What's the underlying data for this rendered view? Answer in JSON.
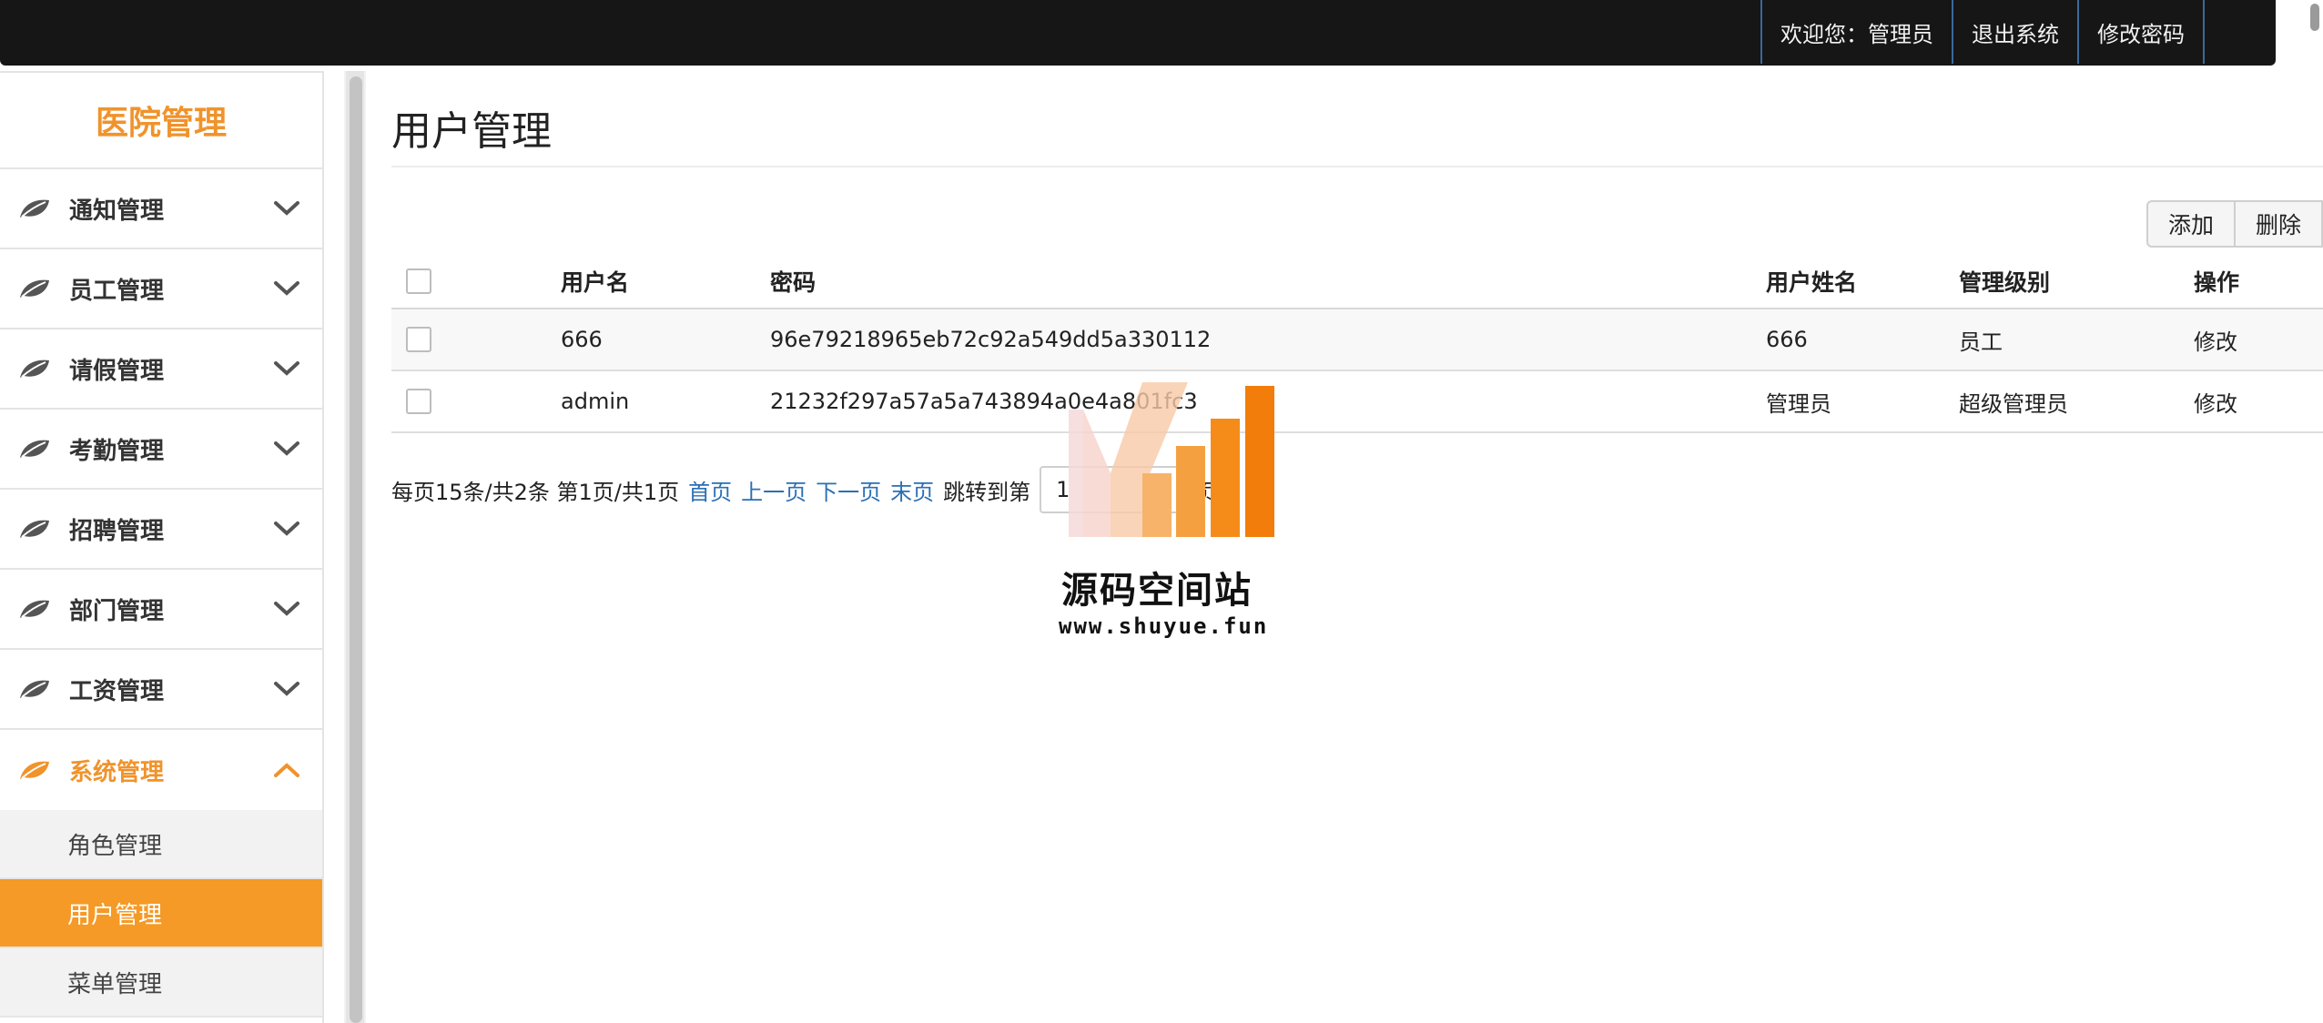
{
  "header": {
    "welcome": "欢迎您：管理员",
    "logout": "退出系统",
    "change_password": "修改密码"
  },
  "sidebar": {
    "brand": "医院管理",
    "items": [
      {
        "label": "通知管理"
      },
      {
        "label": "员工管理"
      },
      {
        "label": "请假管理"
      },
      {
        "label": "考勤管理"
      },
      {
        "label": "招聘管理"
      },
      {
        "label": "部门管理"
      },
      {
        "label": "工资管理"
      },
      {
        "label": "系统管理"
      }
    ],
    "subitems": [
      {
        "label": "角色管理"
      },
      {
        "label": "用户管理"
      },
      {
        "label": "菜单管理"
      }
    ]
  },
  "main": {
    "title": "用户管理",
    "toolbar": {
      "add": "添加",
      "delete": "删除"
    },
    "table": {
      "columns": [
        "用户名",
        "密码",
        "用户姓名",
        "管理级别",
        "操作"
      ],
      "rows": [
        {
          "username": "666",
          "password": "96e79218965eb72c92a549dd5a330112",
          "name": "666",
          "level": "员工",
          "action": "修改"
        },
        {
          "username": "admin",
          "password": "21232f297a57a5a743894a0e4a801fc3",
          "name": "管理员",
          "level": "超级管理员",
          "action": "修改"
        }
      ]
    },
    "pager": {
      "summary": "每页15条/共2条 第1页/共1页",
      "first": "首页",
      "prev": "上一页",
      "next": "下一页",
      "last": "末页",
      "jump_prefix": "跳转到第",
      "jump_value": "1",
      "jump_suffix": "页"
    }
  },
  "watermark": {
    "title": "源码空间站",
    "url": "www.shuyue.fun"
  },
  "colors": {
    "accent": "#f59a26",
    "brand": "#f0932b",
    "link": "#2a6fb5",
    "topbar": "#161616"
  }
}
